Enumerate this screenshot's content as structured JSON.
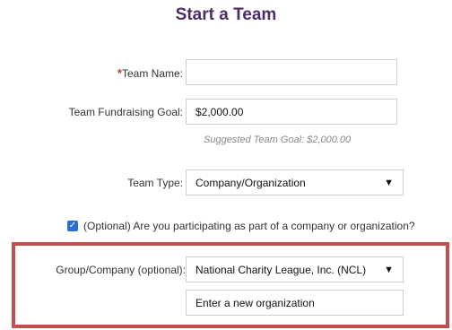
{
  "page": {
    "title": "Start a Team"
  },
  "form": {
    "team_name": {
      "required_mark": "*",
      "label": "Team Name:",
      "value": ""
    },
    "goal": {
      "label": "Team Fundraising Goal:",
      "value": "$2,000.00",
      "hint": "Suggested Team Goal: $2,000.00"
    },
    "team_type": {
      "label": "Team Type:",
      "value": "Company/Organization"
    },
    "company_check": {
      "checked": true,
      "label": "(Optional) Are you participating as part of a company or organization?"
    },
    "group": {
      "label": "Group/Company (optional):",
      "value": "National Charity League, Inc. (NCL)"
    },
    "new_org": {
      "placeholder": "Enter a new organization"
    }
  },
  "colors": {
    "title": "#4b2d6b",
    "highlight_border": "#c0504d",
    "checkbox": "#2a6fd6",
    "required": "#c0392b"
  },
  "icons": {
    "dropdown": "caret-down-icon",
    "check": "checkmark-icon"
  }
}
